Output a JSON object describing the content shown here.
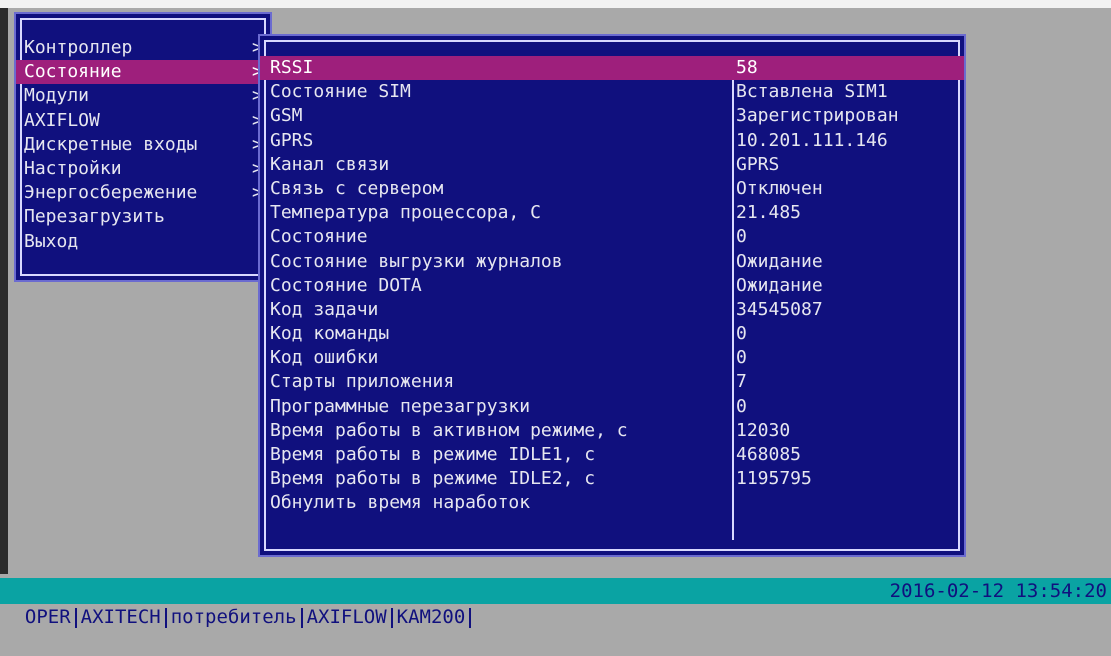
{
  "menu": {
    "items": [
      {
        "label": "Контроллер",
        "arrow": ">",
        "selected": false
      },
      {
        "label": "Состояние",
        "arrow": ">",
        "selected": true
      },
      {
        "label": "Модули",
        "arrow": ">",
        "selected": false
      },
      {
        "label": "AXIFLOW",
        "arrow": ">",
        "selected": false
      },
      {
        "label": "Дискретные входы",
        "arrow": ">",
        "selected": false
      },
      {
        "label": "Настройки",
        "arrow": ">",
        "selected": false
      },
      {
        "label": "Энергосбережение",
        "arrow": ">",
        "selected": false
      },
      {
        "label": "Перезагрузить",
        "arrow": "",
        "selected": false
      },
      {
        "label": "Выход",
        "arrow": "",
        "selected": false
      }
    ]
  },
  "status": {
    "rows": [
      {
        "label": "RSSI",
        "value": "58",
        "selected": true
      },
      {
        "label": "Состояние SIM",
        "value": "Вставлена SIM1"
      },
      {
        "label": "GSM",
        "value": "Зарегистрирован"
      },
      {
        "label": "GPRS",
        "value": "10.201.111.146"
      },
      {
        "label": "Канал связи",
        "value": "GPRS"
      },
      {
        "label": "Связь с сервером",
        "value": "Отключен"
      },
      {
        "label": "Температура процессора, С",
        "value": "21.485"
      },
      {
        "label": "Состояние",
        "value": "0"
      },
      {
        "label": "Состояние выгрузки журналов",
        "value": "Ожидание"
      },
      {
        "label": "Состояние DOTA",
        "value": "Ожидание"
      },
      {
        "label": "Код задачи",
        "value": "34545087"
      },
      {
        "label": "Код команды",
        "value": "0"
      },
      {
        "label": "Код ошибки",
        "value": "0"
      },
      {
        "label": "Старты приложения",
        "value": "7"
      },
      {
        "label": "Программные перезагрузки",
        "value": "0"
      },
      {
        "label": "Время работы в активном режиме, с",
        "value": "12030"
      },
      {
        "label": "Время работы в режиме IDLE1, с",
        "value": "468085"
      },
      {
        "label": "Время работы в режиме IDLE2, с",
        "value": "1195795"
      },
      {
        "label": "Обнулить время наработок",
        "value": ""
      }
    ]
  },
  "statusbar": {
    "segments": [
      "OPER",
      "AXITECH",
      "потребитель",
      "AXIFLOW",
      "KAM200"
    ],
    "datetime": "2016-02-12 13:54:20"
  },
  "colors": {
    "window_bg": "#10107e",
    "selection": "#9e1f7c",
    "statusbar_bg": "#0aa3a3",
    "desktop_bg": "#a9a9a9"
  }
}
